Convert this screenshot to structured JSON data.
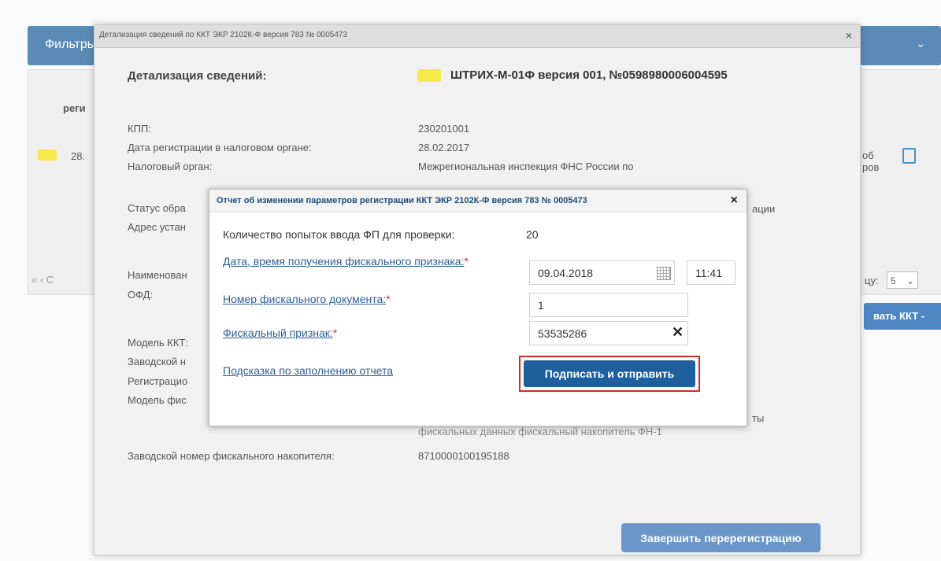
{
  "background": {
    "filter_label": "Фильтры",
    "chevron": "⌄",
    "col_header_1": "реги",
    "row_date_fragment": "28.",
    "row_text_1": "об",
    "row_text_2": "ров",
    "pager": "«  ‹  С",
    "per_page_label": "цу:",
    "per_page_value": "5",
    "right_button": "вать ККТ -"
  },
  "modal1": {
    "title": "Детализация сведений по ККТ ЭКР 2102К-Ф версия 783 № 0005473",
    "close": "×",
    "details_label": "Детализация сведений:",
    "details_value": "ШТРИХ-М-01Ф версия 001, №0598980006004595",
    "rows": [
      {
        "label": "КПП:",
        "value": "230201001"
      },
      {
        "label": "Дата регистрации в налоговом органе:",
        "value": "28.02.2017"
      },
      {
        "label": "Налоговый орган:",
        "value": "Межрегиональная инспекция ФНС России по"
      },
      {
        "label": "Статус обра",
        "value": "ации"
      },
      {
        "label": "Адрес устан",
        "value": ""
      },
      {
        "label": "Наименован",
        "value": ""
      },
      {
        "label": "ОФД:",
        "value": ""
      },
      {
        "label": "Модель ККТ:",
        "value": ""
      },
      {
        "label": "Заводской н",
        "value": ""
      },
      {
        "label": "Регистрацио",
        "value": ""
      },
      {
        "label": "Модель фис",
        "value": "ты"
      }
    ],
    "fn_model_line2": "фискальных данных фискальный накопитель ФН-1",
    "fn_serial_label": "Заводской номер фискального накопителя:",
    "fn_serial_value": "8710000100195188",
    "finish_button": "Завершить перерегистрацию"
  },
  "modal2": {
    "title": "Отчет об изменении параметров регистрации ККТ ЭКР 2102К-Ф версия 783 № 0005473",
    "close": "×",
    "attempts_label": "Количество попыток ввода ФП для проверки:",
    "attempts_value": "20",
    "fp_datetime_label": "Дата, время получения фискального признака:",
    "fp_date_value": "09.04.2018",
    "fp_time_value": "11:41",
    "fd_number_label": "Номер фискального документа:",
    "fd_number_value": "1",
    "fp_label": "Фискальный признак:",
    "fp_value": "53535286",
    "required_mark": "*",
    "clear": "✕",
    "hint_link": "Подсказка по заполнению отчета",
    "sign_button": "Подписать и отправить"
  },
  "colors": {
    "header_blue": "#5b8ab6",
    "primary_button": "#1e5f9e",
    "highlight_border": "#d22b2b",
    "link": "#2d5f99",
    "marker_yellow": "#f5e84a"
  }
}
